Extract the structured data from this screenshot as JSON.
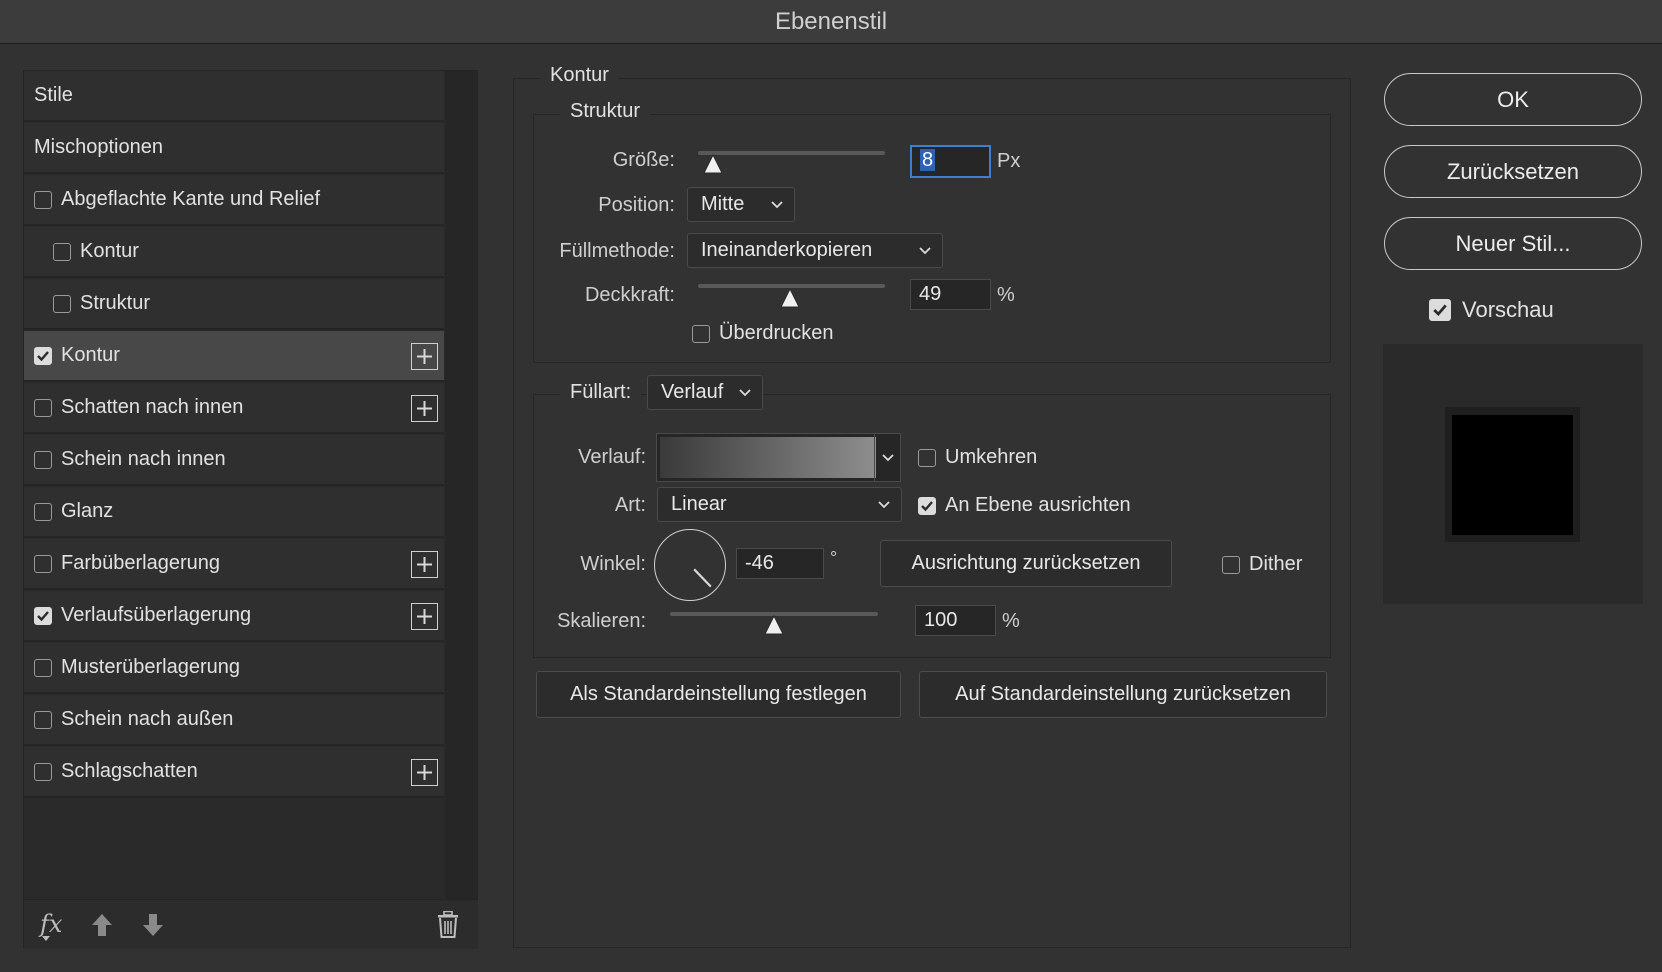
{
  "window": {
    "title": "Ebenenstil"
  },
  "styles_list": {
    "items": [
      {
        "label": "Stile",
        "checkbox": false,
        "checked": false,
        "indent": false,
        "plus": false,
        "active": false
      },
      {
        "label": "Mischoptionen",
        "checkbox": false,
        "checked": false,
        "indent": false,
        "plus": false,
        "active": false
      },
      {
        "label": "Abgeflachte Kante und Relief",
        "checkbox": true,
        "checked": false,
        "indent": false,
        "plus": false,
        "active": false
      },
      {
        "label": "Kontur",
        "checkbox": true,
        "checked": false,
        "indent": true,
        "plus": false,
        "active": false
      },
      {
        "label": "Struktur",
        "checkbox": true,
        "checked": false,
        "indent": true,
        "plus": false,
        "active": false
      },
      {
        "label": "Kontur",
        "checkbox": true,
        "checked": true,
        "indent": false,
        "plus": true,
        "active": true
      },
      {
        "label": "Schatten nach innen",
        "checkbox": true,
        "checked": false,
        "indent": false,
        "plus": true,
        "active": false
      },
      {
        "label": "Schein nach innen",
        "checkbox": true,
        "checked": false,
        "indent": false,
        "plus": false,
        "active": false
      },
      {
        "label": "Glanz",
        "checkbox": true,
        "checked": false,
        "indent": false,
        "plus": false,
        "active": false
      },
      {
        "label": "Farbüberlagerung",
        "checkbox": true,
        "checked": false,
        "indent": false,
        "plus": true,
        "active": false
      },
      {
        "label": "Verlaufsüberlagerung",
        "checkbox": true,
        "checked": true,
        "indent": false,
        "plus": true,
        "active": false
      },
      {
        "label": "Musterüberlagerung",
        "checkbox": true,
        "checked": false,
        "indent": false,
        "plus": false,
        "active": false
      },
      {
        "label": "Schein nach außen",
        "checkbox": true,
        "checked": false,
        "indent": false,
        "plus": false,
        "active": false
      },
      {
        "label": "Schlagschatten",
        "checkbox": true,
        "checked": false,
        "indent": false,
        "plus": true,
        "active": false
      }
    ],
    "footer": {
      "fx_label": "fx"
    }
  },
  "kontur": {
    "section_title": "Kontur",
    "struktur": {
      "title": "Struktur",
      "groesse_label": "Größe:",
      "groesse_value": "8",
      "groesse_slider": 0.08,
      "groesse_unit": "Px",
      "position_label": "Position:",
      "position_value": "Mitte",
      "fuellmethode_label": "Füllmethode:",
      "fuellmethode_value": "Ineinanderkopieren",
      "deckkraft_label": "Deckkraft:",
      "deckkraft_value": "49",
      "deckkraft_unit": "%",
      "ueberdrucken_label": "Überdrucken",
      "ueberdrucken_checked": false
    },
    "fuellart": {
      "label": "Füllart:",
      "value": "Verlauf",
      "verlauf_label": "Verlauf:",
      "umkehren_label": "Umkehren",
      "umkehren_checked": false,
      "art_label": "Art:",
      "art_value": "Linear",
      "an_ebene_label": "An Ebene ausrichten",
      "an_ebene_checked": true,
      "winkel_label": "Winkel:",
      "winkel_value": "-46",
      "winkel_unit": "°",
      "ausrichtung_button": "Ausrichtung zurücksetzen",
      "dither_label": "Dither",
      "dither_checked": false,
      "skalieren_label": "Skalieren:",
      "skalieren_value": "100",
      "skalieren_unit": "%"
    },
    "buttons": {
      "set_default": "Als Standardeinstellung festlegen",
      "reset_default": "Auf Standardeinstellung zurücksetzen"
    }
  },
  "right": {
    "ok": "OK",
    "reset": "Zurücksetzen",
    "new_style": "Neuer Stil...",
    "vorschau_label": "Vorschau",
    "vorschau_checked": true
  }
}
